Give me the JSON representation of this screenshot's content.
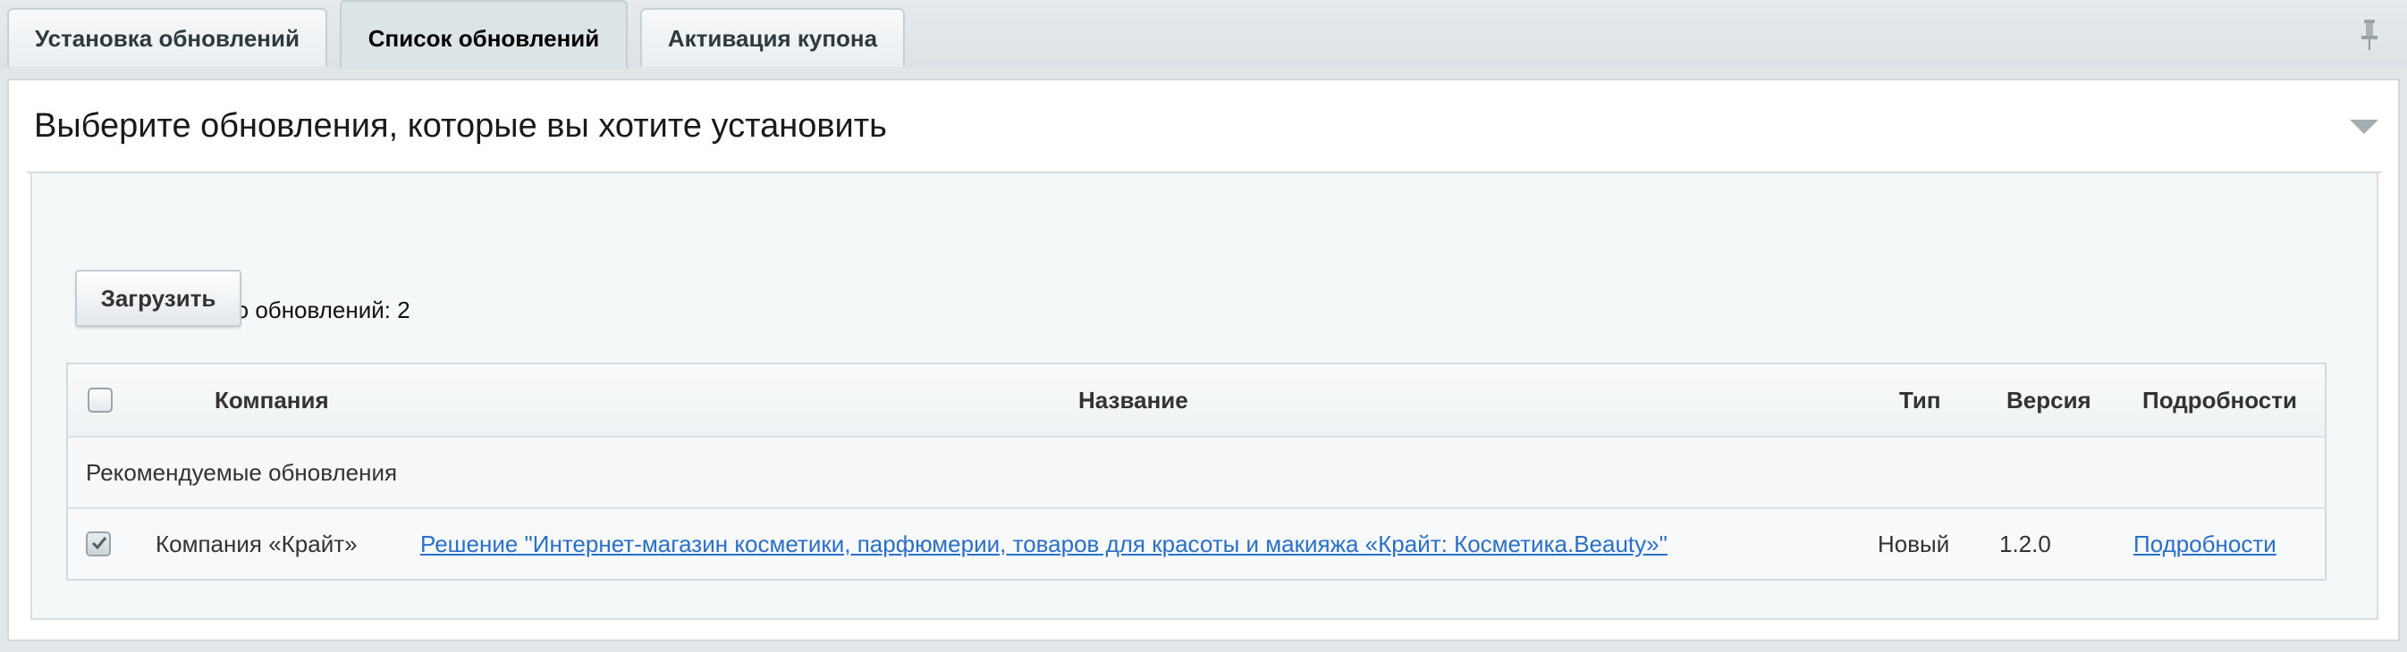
{
  "tabs": [
    {
      "label": "Установка обновлений",
      "active": false
    },
    {
      "label": "Список обновлений",
      "active": true
    },
    {
      "label": "Активация купона",
      "active": false
    }
  ],
  "panel": {
    "title": "Выберите обновления, которые вы хотите установить",
    "total_text": "Всего доступно обновлений: 2",
    "load_button": "Загрузить"
  },
  "table": {
    "headers": {
      "company": "Компания",
      "name": "Название",
      "type": "Тип",
      "version": "Версия",
      "details": "Подробности"
    },
    "group_label": "Рекомендуемые обновления",
    "rows": [
      {
        "checked": true,
        "company": "Компания «Крайт»",
        "name": "Решение \"Интернет-магазин косметики, парфюмерии, товаров для красоты и макияжа «Крайт: Косметика.Beauty»\"",
        "type": "Новый",
        "version": "1.2.0",
        "details": "Подробности"
      }
    ]
  },
  "colors": {
    "link": "#2a6fc9",
    "background": "#e1e6e9",
    "panel": "#ffffff"
  },
  "icons": {
    "pin": "pin-icon",
    "collapse": "chevron-down-icon",
    "check": "check-icon"
  }
}
